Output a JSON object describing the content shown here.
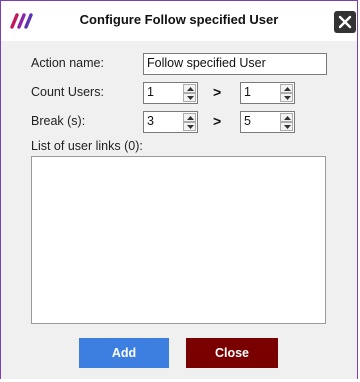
{
  "window": {
    "title": "Configure Follow specified User",
    "app_icon": "brand-slashes-icon",
    "close_icon": "close-x-icon"
  },
  "form": {
    "action_name_label": "Action name:",
    "action_name_value": "Follow specified User",
    "count_users_label": "Count Users:",
    "count_users_min": "1",
    "count_users_max": "1",
    "break_label": "Break (s):",
    "break_min": "3",
    "break_max": "5",
    "separator": ">",
    "list_label": "List of user links (0):"
  },
  "buttons": {
    "add_label": "Add",
    "close_label": "Close"
  },
  "colors": {
    "accent_border": "#7a3fb0",
    "add_button": "#3c7fe0",
    "close_button": "#7a0000",
    "close_icon_bg": "#333333"
  }
}
